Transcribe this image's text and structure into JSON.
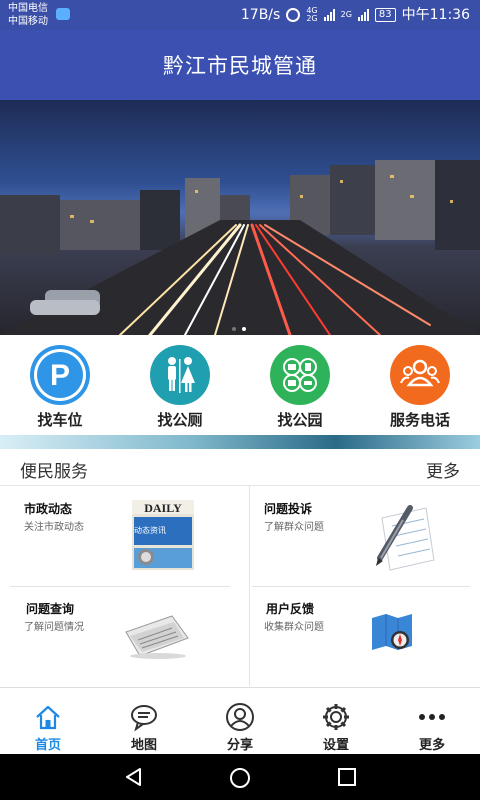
{
  "status_bar": {
    "carrier_1": "中国电信",
    "carrier_2": "中国移动",
    "net_speed": "17B/s",
    "net_4g": "4G",
    "net_2g_a": "2G",
    "net_2g_b": "2G",
    "battery": "83",
    "time": "中午11:36"
  },
  "header": {
    "title": "黔江市民城管通"
  },
  "banner": {
    "slide_count": 2,
    "active_slide": 2
  },
  "quick_actions": [
    {
      "label": "找车位",
      "icon": "parking-icon",
      "color": "#2f95e6"
    },
    {
      "label": "找公厕",
      "icon": "toilet-icon",
      "color": "#1f9fb0"
    },
    {
      "label": "找公园",
      "icon": "park-icon",
      "color": "#2fb35a"
    },
    {
      "label": "服务电话",
      "icon": "people-icon",
      "color": "#f26a1d"
    }
  ],
  "services": {
    "title": "便民服务",
    "more": "更多",
    "items": [
      {
        "title": "市政动态",
        "subtitle": "关注市政动态",
        "icon": "newspaper-daily-icon",
        "image_text": "DAILY",
        "image_caption": "动态资讯"
      },
      {
        "title": "问题投诉",
        "subtitle": "了解群众问题",
        "icon": "pen-paper-icon"
      },
      {
        "title": "问题查询",
        "subtitle": "了解问题情况",
        "icon": "newspaper-icon"
      },
      {
        "title": "用户反馈",
        "subtitle": "收集群众问题",
        "icon": "map-compass-icon"
      }
    ]
  },
  "bottom_nav": [
    {
      "label": "首页",
      "icon": "home-icon",
      "active": true
    },
    {
      "label": "地图",
      "icon": "chat-bubble-icon",
      "active": false
    },
    {
      "label": "分享",
      "icon": "user-circle-icon",
      "active": false
    },
    {
      "label": "设置",
      "icon": "gear-icon",
      "active": false
    },
    {
      "label": "更多",
      "icon": "more-dots-icon",
      "active": false
    }
  ]
}
